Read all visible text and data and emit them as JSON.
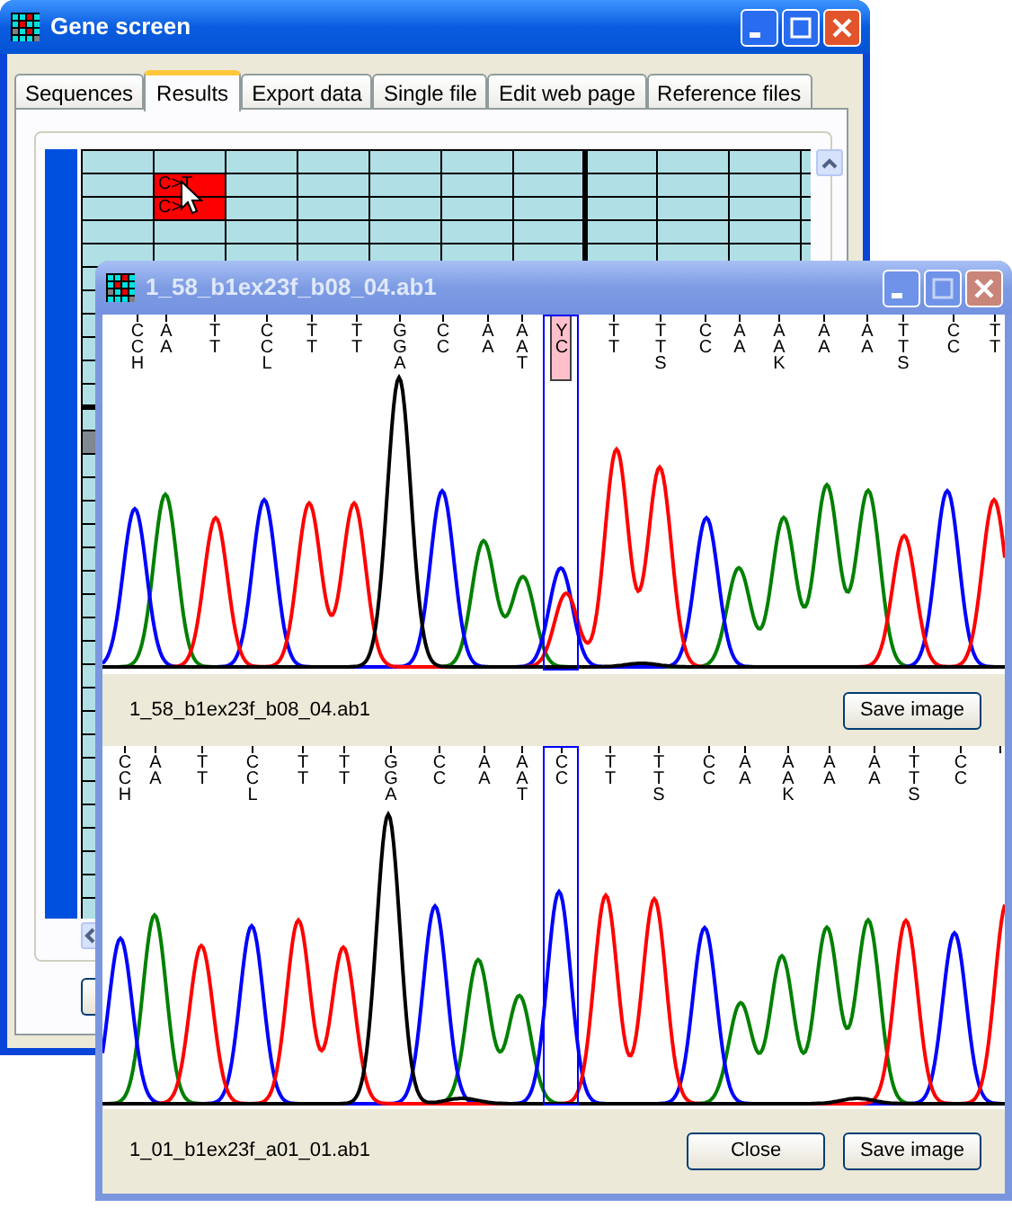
{
  "main_window": {
    "title": "Gene screen",
    "active": true,
    "tabs": [
      {
        "label": "Sequences",
        "selected": false
      },
      {
        "label": "Results",
        "selected": true
      },
      {
        "label": "Export data",
        "selected": false
      },
      {
        "label": "Single file",
        "selected": false
      },
      {
        "label": "Edit web page",
        "selected": false
      },
      {
        "label": "Reference files",
        "selected": false
      }
    ],
    "results_grid": {
      "flagged_cells": [
        {
          "text": "C>T",
          "flagged": true
        },
        {
          "text": "C>",
          "flagged": true
        }
      ]
    }
  },
  "trace_window": {
    "title": "1_58_b1ex23f_b08_04.ab1",
    "active": false,
    "panels": [
      {
        "base_calls": [
          {
            "letters": [
              "C",
              "C",
              "H"
            ],
            "boxed": false,
            "highlighted": false
          },
          {
            "letters": [
              "A",
              "A"
            ],
            "boxed": false,
            "highlighted": false
          },
          {
            "letters": [
              "T",
              "T"
            ],
            "boxed": false,
            "highlighted": false
          },
          {
            "letters": [
              "C",
              "C",
              "L"
            ],
            "boxed": false,
            "highlighted": false
          },
          {
            "letters": [
              "T",
              "T"
            ],
            "boxed": false,
            "highlighted": false
          },
          {
            "letters": [
              "T",
              "T"
            ],
            "boxed": false,
            "highlighted": false
          },
          {
            "letters": [
              "G",
              "G",
              "A"
            ],
            "boxed": false,
            "highlighted": false
          },
          {
            "letters": [
              "C",
              "C"
            ],
            "boxed": false,
            "highlighted": false
          },
          {
            "letters": [
              "A",
              "A"
            ],
            "boxed": false,
            "highlighted": false
          },
          {
            "letters": [
              "A",
              "A",
              "T"
            ],
            "boxed": false,
            "highlighted": false
          },
          {
            "letters": [
              "Y",
              "C"
            ],
            "boxed": true,
            "highlighted": true
          },
          {
            "letters": [
              "T",
              "T"
            ],
            "boxed": false,
            "highlighted": false
          },
          {
            "letters": [
              "T",
              "T",
              "S"
            ],
            "boxed": false,
            "highlighted": false
          },
          {
            "letters": [
              "C",
              "C"
            ],
            "boxed": false,
            "highlighted": false
          },
          {
            "letters": [
              "A",
              "A"
            ],
            "boxed": false,
            "highlighted": false
          },
          {
            "letters": [
              "A",
              "A",
              "K"
            ],
            "boxed": false,
            "highlighted": false
          },
          {
            "letters": [
              "A",
              "A"
            ],
            "boxed": false,
            "highlighted": false
          },
          {
            "letters": [
              "A",
              "A"
            ],
            "boxed": false,
            "highlighted": false
          },
          {
            "letters": [
              "T",
              "T",
              "S"
            ],
            "boxed": false,
            "highlighted": false
          },
          {
            "letters": [
              "C",
              "C"
            ],
            "boxed": false,
            "highlighted": false
          },
          {
            "letters": [
              "T",
              "T"
            ],
            "boxed": false,
            "highlighted": false
          }
        ],
        "file_name": "1_58_b1ex23f_b08_04.ab1",
        "buttons": [
          "Save image"
        ]
      },
      {
        "base_calls": [
          {
            "letters": [
              "C",
              "C",
              "H"
            ],
            "boxed": false,
            "highlighted": false
          },
          {
            "letters": [
              "A",
              "A"
            ],
            "boxed": false,
            "highlighted": false
          },
          {
            "letters": [
              "T",
              "T"
            ],
            "boxed": false,
            "highlighted": false
          },
          {
            "letters": [
              "C",
              "C",
              "L"
            ],
            "boxed": false,
            "highlighted": false
          },
          {
            "letters": [
              "T",
              "T"
            ],
            "boxed": false,
            "highlighted": false
          },
          {
            "letters": [
              "T",
              "T"
            ],
            "boxed": false,
            "highlighted": false
          },
          {
            "letters": [
              "G",
              "G",
              "A"
            ],
            "boxed": false,
            "highlighted": false
          },
          {
            "letters": [
              "C",
              "C"
            ],
            "boxed": false,
            "highlighted": false
          },
          {
            "letters": [
              "A",
              "A"
            ],
            "boxed": false,
            "highlighted": false
          },
          {
            "letters": [
              "A",
              "A",
              "T"
            ],
            "boxed": false,
            "highlighted": false
          },
          {
            "letters": [
              "C",
              "C"
            ],
            "boxed": true,
            "highlighted": false
          },
          {
            "letters": [
              "T",
              "T"
            ],
            "boxed": false,
            "highlighted": false
          },
          {
            "letters": [
              "T",
              "T",
              "S"
            ],
            "boxed": false,
            "highlighted": false
          },
          {
            "letters": [
              "C",
              "C"
            ],
            "boxed": false,
            "highlighted": false
          },
          {
            "letters": [
              "A",
              "A"
            ],
            "boxed": false,
            "highlighted": false
          },
          {
            "letters": [
              "A",
              "A",
              "K"
            ],
            "boxed": false,
            "highlighted": false
          },
          {
            "letters": [
              "A",
              "A"
            ],
            "boxed": false,
            "highlighted": false
          },
          {
            "letters": [
              "A",
              "A"
            ],
            "boxed": false,
            "highlighted": false
          },
          {
            "letters": [
              "T",
              "T",
              "S"
            ],
            "boxed": false,
            "highlighted": false
          },
          {
            "letters": [
              "C",
              "C"
            ],
            "boxed": false,
            "highlighted": false
          }
        ],
        "file_name": "1_01_b1ex23f_a01_01.ab1",
        "buttons": [
          "Close",
          "Save image"
        ]
      }
    ]
  }
}
